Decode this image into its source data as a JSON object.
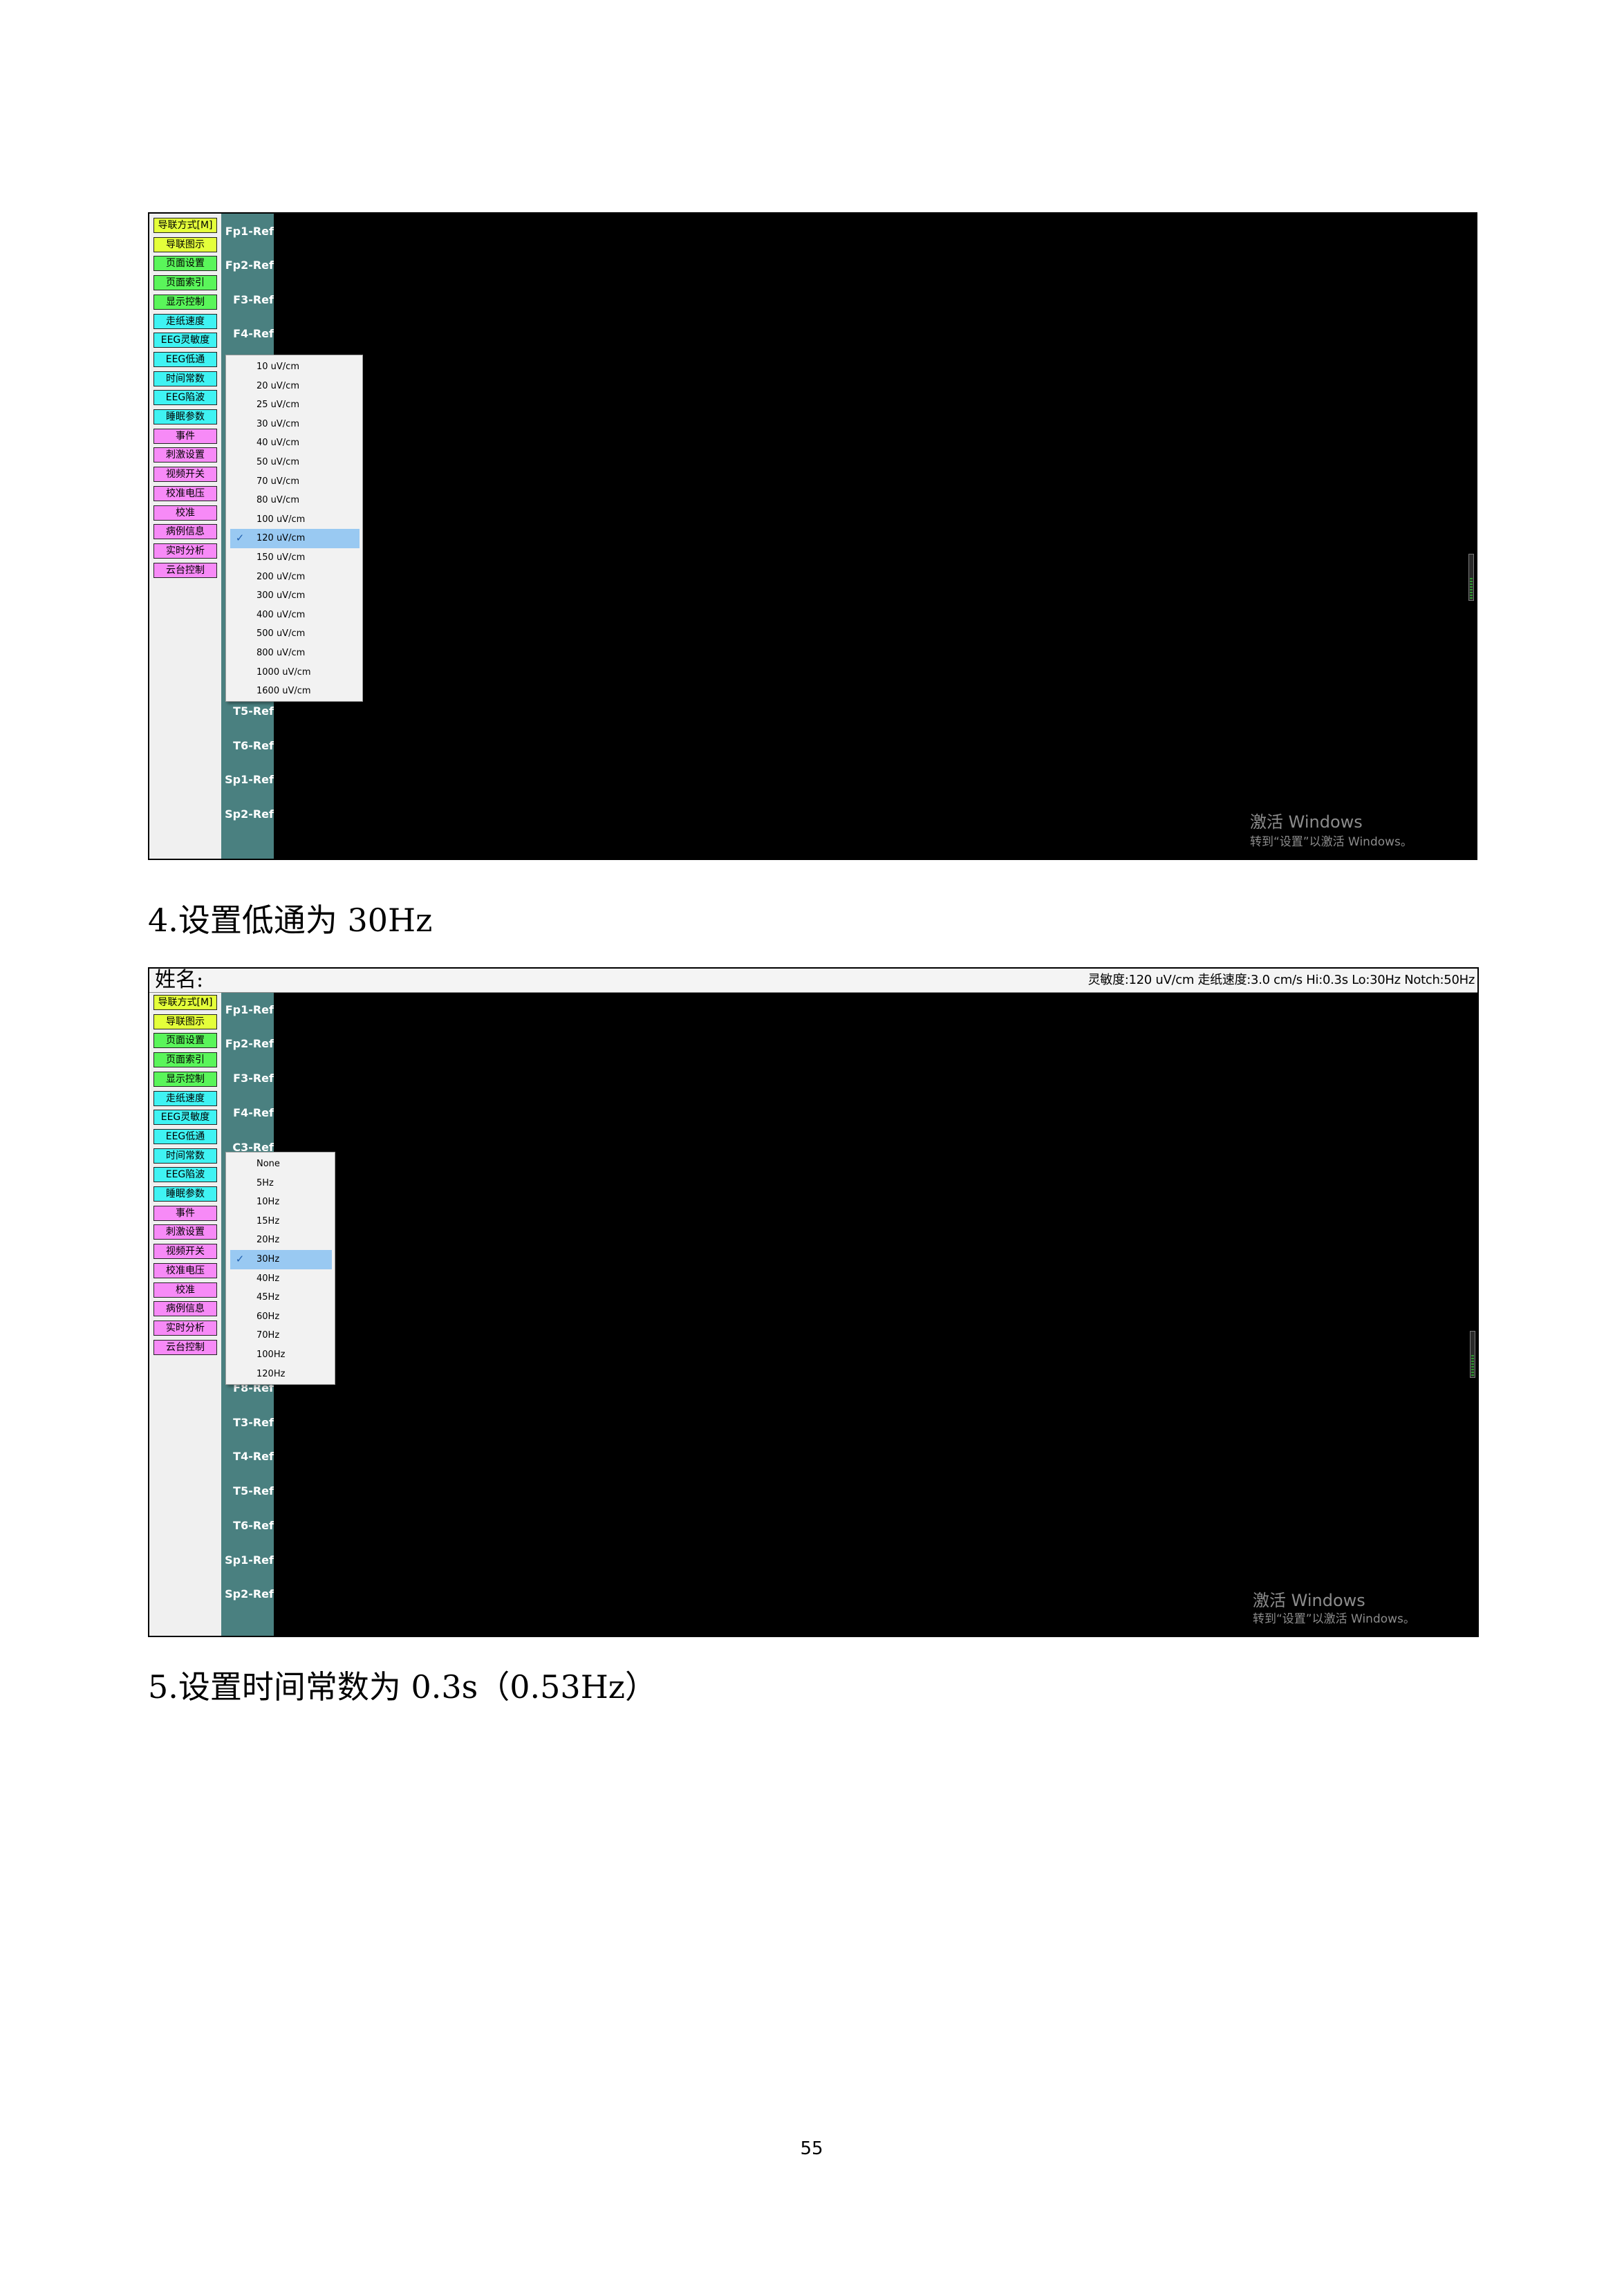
{
  "colors": {
    "yellow": "#e4ff3a",
    "green": "#5af55a",
    "cyan": "#3ff3f3",
    "pink": "#f78af7",
    "channel_column": "#4a8080",
    "selected_highlight": "#99c9f2"
  },
  "sidebar": {
    "buttons": [
      {
        "label": "导联方式[M]",
        "color": "yellow"
      },
      {
        "label": "导联图示",
        "color": "yellow"
      },
      {
        "label": "页面设置",
        "color": "green"
      },
      {
        "label": "页面索引",
        "color": "green"
      },
      {
        "label": "显示控制",
        "color": "green"
      },
      {
        "label": "走纸速度",
        "color": "cyan"
      },
      {
        "label": "EEG灵敏度",
        "color": "cyan"
      },
      {
        "label": "EEG低通",
        "color": "cyan"
      },
      {
        "label": "时间常数",
        "color": "cyan"
      },
      {
        "label": "EEG陷波",
        "color": "cyan"
      },
      {
        "label": "睡眠参数",
        "color": "cyan"
      },
      {
        "label": "事件",
        "color": "pink"
      },
      {
        "label": "刺激设置",
        "color": "pink"
      },
      {
        "label": "视频开关",
        "color": "pink"
      },
      {
        "label": "校准电压",
        "color": "pink"
      },
      {
        "label": "校准",
        "color": "pink"
      },
      {
        "label": "病例信息",
        "color": "pink"
      },
      {
        "label": "实时分析",
        "color": "pink"
      },
      {
        "label": "云台控制",
        "color": "pink"
      }
    ]
  },
  "screenshots": [
    {
      "channels": [
        "Fp1-Ref",
        "Fp2-Ref",
        "F3-Ref",
        "F4-Ref",
        "",
        "",
        "",
        "",
        "",
        "",
        "",
        "",
        "",
        "",
        "T5-Ref",
        "T6-Ref",
        "Sp1-Ref",
        "Sp2-Ref"
      ],
      "dropdown": {
        "items": [
          "10 uV/cm",
          "20 uV/cm",
          "25 uV/cm",
          "30 uV/cm",
          "40 uV/cm",
          "50 uV/cm",
          "70 uV/cm",
          "80 uV/cm",
          "100 uV/cm",
          "120 uV/cm",
          "150 uV/cm",
          "200 uV/cm",
          "300 uV/cm",
          "400 uV/cm",
          "500 uV/cm",
          "800 uV/cm",
          "1000 uV/cm",
          "1600 uV/cm"
        ],
        "selected": "120 uV/cm"
      },
      "watermark": {
        "title": "激活 Windows",
        "subtitle": "转到“设置”以激活 Windows。"
      }
    },
    {
      "header": {
        "name_label": "姓名:",
        "status": "灵敏度:120 uV/cm 走纸速度:3.0 cm/s Hi:0.3s Lo:30Hz Notch:50Hz"
      },
      "channels": [
        "Fp1-Ref",
        "Fp2-Ref",
        "F3-Ref",
        "F4-Ref",
        "C3-Ref",
        "",
        "",
        "",
        "",
        "",
        "",
        "F8-Ref",
        "T3-Ref",
        "T4-Ref",
        "T5-Ref",
        "T6-Ref",
        "Sp1-Ref",
        "Sp2-Ref"
      ],
      "dropdown": {
        "items": [
          "None",
          "5Hz",
          "10Hz",
          "15Hz",
          "20Hz",
          "30Hz",
          "40Hz",
          "45Hz",
          "60Hz",
          "70Hz",
          "100Hz",
          "120Hz"
        ],
        "selected": "30Hz"
      },
      "watermark": {
        "title": "激活 Windows",
        "subtitle": "转到“设置”以激活 Windows。"
      }
    }
  ],
  "captions": [
    "4.设置低通为 30Hz",
    "5.设置时间常数为 0.3s（0.53Hz）"
  ],
  "page_number": "55"
}
